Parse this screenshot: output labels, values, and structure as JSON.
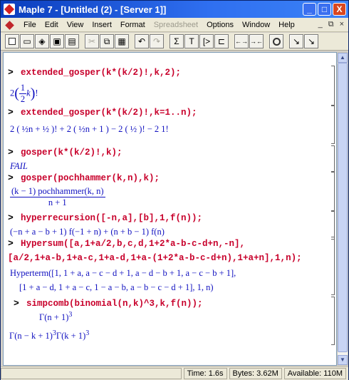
{
  "window": {
    "title": "Maple 7 - [Untitled (2) - [Server 1]]",
    "min": "_",
    "max": "□",
    "close": "X"
  },
  "menu": {
    "items": [
      "File",
      "Edit",
      "View",
      "Insert",
      "Format",
      "Spreadsheet",
      "Options",
      "Window",
      "Help"
    ],
    "mdi_min": "_",
    "mdi_restore": "⧉",
    "mdi_close": "×"
  },
  "toolbar": {
    "undo": "↶",
    "redo": "↷",
    "sigma": "Σ",
    "text": "T",
    "bracket": "[>",
    "insert_after": "⊏",
    "left": "←→",
    "right": "→←",
    "zoom_in": "↘",
    "zoom_out": "↘"
  },
  "worksheet": {
    "prompt": ">",
    "cmd1": "extended_gosper(k*(k/2)!,k,2);",
    "out1_a": "2",
    "out1_half": "1",
    "out1_two": "2",
    "out1_k": "k",
    "out1_bang": "!",
    "cmd2": "extended_gosper(k*(k/2)!,k=1..n);",
    "out2_text": "2 ( ½n + ½ )! + 2 ( ½n + 1 ) − 2 ( ½ )! − 2 1!",
    "cmd3": "gosper(k*(k/2)!,k);",
    "out3": "FAIL",
    "cmd4": "gosper(pochhammer(k,n),k);",
    "out4_num": "(k − 1) pochhammer(k, n)",
    "out4_den": "n + 1",
    "cmd5": "hyperrecursion([-n,a],[b],1,f(n));",
    "out5": "(−n + a − b + 1) f(−1 + n) + (n + b − 1) f(n)",
    "cmd6a": "Hypersum([a,1+a/2,b,c,d,1+2*a-b-c-d+n,-n],",
    "cmd6b": "[a/2,1+a-b,1+a-c,1+a-d,1+a-(1+2*a-b-c-d+n),1+a+n],1,n);",
    "out6a": "Hyperterm([1, 1 + a, a − c − d + 1, a − d − b + 1, a − c − b + 1],",
    "out6b": "[1 + a − d, 1 + a − c, 1 − a − b, a − b − c − d + 1], 1, n)",
    "cmd7": "simpcomb(binomial(n,k)^3,k,f(n));",
    "out7_num": "Γ(n + 1)",
    "out7_num_exp": "3",
    "out7_den": "Γ(n − k + 1)",
    "out7_den_exp": "3",
    "out7_den2": "Γ(k + 1)",
    "out7_den2_exp": "3"
  },
  "status": {
    "time": "Time: 1.6s",
    "bytes": "Bytes: 3.62M",
    "available": "Available: 110M"
  },
  "colors": {
    "command": "#c8002b",
    "output": "#1010c0",
    "title_bar": "#0a3dbd"
  }
}
